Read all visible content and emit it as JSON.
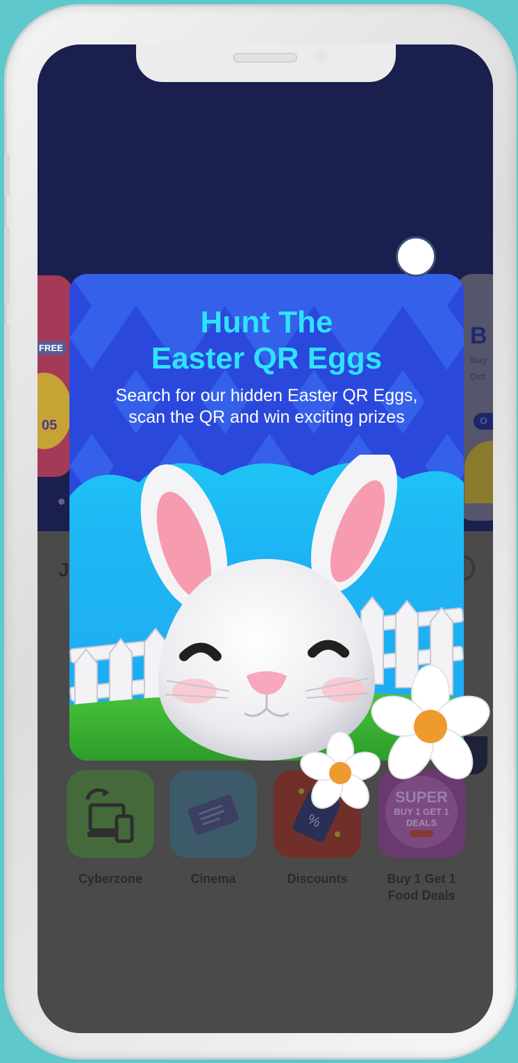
{
  "popup": {
    "title_line1": "Hunt The",
    "title_line2": "Easter QR Eggs",
    "subtitle_line1": "Search for our hidden Easter QR Eggs,",
    "subtitle_line2": "scan the QR and win exciting prizes"
  },
  "background": {
    "left_card": {
      "badge": "FREE",
      "number": "05"
    },
    "right_card": {
      "heading": "B",
      "line1": "Buy",
      "line2": "Oct",
      "pill": "O"
    },
    "section_letter": "J"
  },
  "categories": [
    {
      "label": "Cyberzone",
      "icon": "devices-icon",
      "color": "#446a3c"
    },
    {
      "label": "Cinema",
      "icon": "ticket-icon",
      "color": "#3c5a69"
    },
    {
      "label": "Discounts",
      "icon": "discount-tag-icon",
      "color": "#703029"
    },
    {
      "label_line1": "Buy 1 Get 1",
      "label_line2": "Food Deals",
      "tile_line1": "SUPER",
      "tile_line2": "BUY 1 GET 1",
      "tile_line3": "DEALS",
      "icon": "super-deals-icon",
      "color": "#6a3a6e"
    }
  ],
  "colors": {
    "title": "#2ee3ff",
    "popup_bg": "#2a4de0",
    "screen_bg": "#1a1f4e",
    "overlay": "#4a4a4a"
  }
}
